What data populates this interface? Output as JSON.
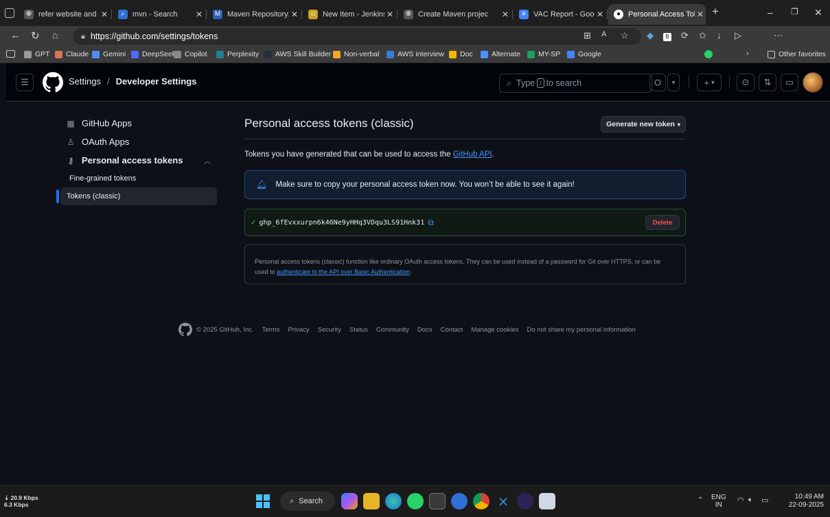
{
  "browser": {
    "tabs": [
      {
        "title": "refer website and giv",
        "icon_color": "#555555",
        "icon": "openai-icon"
      },
      {
        "title": "mvn - Search",
        "icon_color": "#2f6fd6",
        "icon": "search-icon"
      },
      {
        "title": "Maven Repository: o",
        "icon_color": "#2b5fb8",
        "icon": "maven-icon"
      },
      {
        "title": "New Item - Jenkins",
        "icon_color": "#c9a227",
        "icon": "jenkins-icon"
      },
      {
        "title": "Create Maven projec",
        "icon_color": "#555555",
        "icon": "openai-icon"
      },
      {
        "title": "VAC Report - Google",
        "icon_color": "#4285f4",
        "icon": "docs-icon"
      },
      {
        "title": "Personal Access Toke",
        "icon_color": "#ffffff",
        "icon": "github-icon"
      }
    ],
    "url": "https://github.com/settings/tokens",
    "favorites": [
      "GPT",
      "Claude",
      "Gemini",
      "DeepSeek",
      "Copilot",
      "Perplexity",
      "AWS Skill Builder",
      "Non-verbal",
      "AWS interview",
      "Doc",
      "Alternate",
      "MY-SP",
      "Google"
    ],
    "other_favorites": "Other favorites",
    "badge_count": "8"
  },
  "header": {
    "breadcrumb_root": "Settings",
    "breadcrumb_sep": "/",
    "breadcrumb_current": "Developer Settings",
    "search_prefix": "Type",
    "search_key": "/",
    "search_suffix": "to search"
  },
  "sidebar": {
    "items": [
      {
        "label": "GitHub Apps"
      },
      {
        "label": "OAuth Apps"
      },
      {
        "label": "Personal access tokens"
      }
    ],
    "subitems": [
      {
        "label": "Fine-grained tokens"
      },
      {
        "label": "Tokens (classic)"
      }
    ]
  },
  "main": {
    "title": "Personal access tokens (classic)",
    "generate_button": "Generate new token",
    "intro_text": "Tokens you have generated that can be used to access the",
    "intro_link": "GitHub API",
    "intro_end": ".",
    "flash": "Make sure to copy your personal access token now. You won’t be able to see it again!",
    "token": "ghp_6fEvxxurpn6k46Ne9yHHq3VDqu3LS91Hnk31",
    "delete_button": "Delete",
    "info_text": "Personal access tokens (classic) function like ordinary OAuth access tokens. They can be used instead of a password for Git over HTTPS, or can be used to",
    "info_link": "authenticate to the API over Basic Authentication",
    "info_end": "."
  },
  "footer": {
    "copyright": "© 2025 GitHub, Inc.",
    "links": [
      "Terms",
      "Privacy",
      "Security",
      "Status",
      "Community",
      "Docs",
      "Contact",
      "Manage cookies",
      "Do not share my personal information"
    ]
  },
  "taskbar": {
    "net_down": "⇣ 20.9 Kbps",
    "net_up": "6.3 Kbps",
    "search_label": "Search",
    "lang": "ENG",
    "region": "IN",
    "time": "10:49 AM",
    "date": "22-09-2025"
  }
}
